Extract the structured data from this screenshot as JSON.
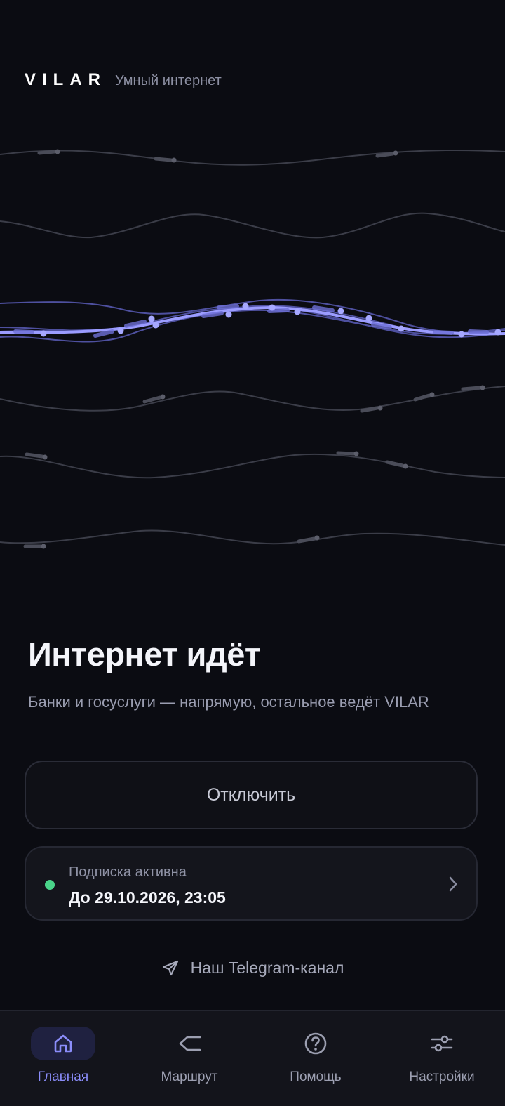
{
  "brand": {
    "logo": "VILAR",
    "tagline": "Умный интернет"
  },
  "status": {
    "title": "Интернет идёт",
    "description": "Банки и госуслуги — напрямую, остальное ведёт VILAR"
  },
  "actions": {
    "disconnect_label": "Отключить"
  },
  "subscription": {
    "label": "Подписка активна",
    "until": "До 29.10.2026, 23:05",
    "status_color": "#4ad48a"
  },
  "telegram": {
    "label": "Наш Telegram-канал",
    "icon": "paper-plane-icon"
  },
  "nav": {
    "items": [
      {
        "label": "Главная",
        "icon": "home-icon",
        "active": true
      },
      {
        "label": "Маршрут",
        "icon": "route-icon",
        "active": false
      },
      {
        "label": "Помощь",
        "icon": "help-icon",
        "active": false
      },
      {
        "label": "Настройки",
        "icon": "settings-sliders-icon",
        "active": false
      }
    ]
  },
  "colors": {
    "background": "#0b0c12",
    "accent": "#8b8dfa",
    "muted_line": "#3a3c47",
    "success": "#4ad48a"
  }
}
